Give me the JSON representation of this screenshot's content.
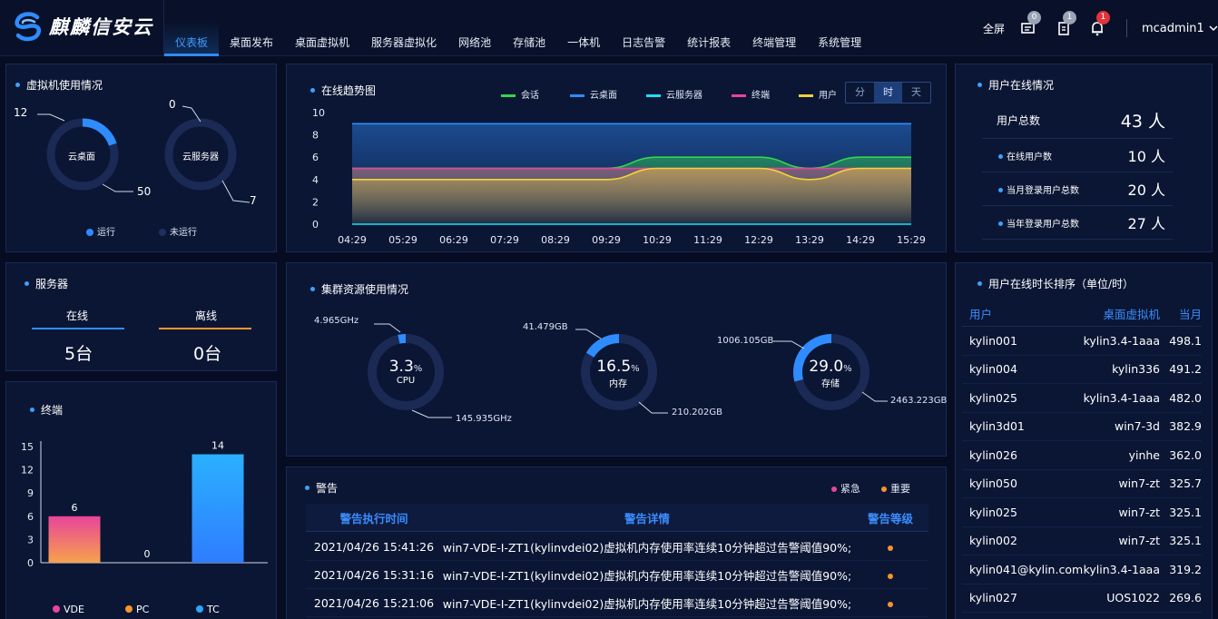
{
  "app": {
    "logo_text": "麒麟信安云"
  },
  "nav": {
    "items": [
      "仪表板",
      "桌面发布",
      "桌面虚拟机",
      "服务器虚拟化",
      "网络池",
      "存储池",
      "一体机",
      "日志告警",
      "统计报表",
      "终端管理",
      "系统管理"
    ],
    "active_index": 0
  },
  "header": {
    "fullscreen": "全屏",
    "badges": [
      "0",
      "1",
      "1"
    ],
    "user": "mcadmin1"
  },
  "colors": {
    "accent": "#2f8cff",
    "green": "#32d64c",
    "blue": "#2f8cff",
    "cyan": "#17e2f5",
    "pink": "#e8459b",
    "yellow": "#f4d23a"
  },
  "vm_usage": {
    "title": "虚拟机使用情况",
    "desktop": {
      "label": "云桌面",
      "running": "12",
      "idle": "50"
    },
    "server": {
      "label": "云服务器",
      "running": "0",
      "idle": "7"
    },
    "legend_running": "运行",
    "legend_idle": "未运行"
  },
  "servers": {
    "title": "服务器",
    "online_label": "在线",
    "offline_label": "离线",
    "online": "5台",
    "offline": "0台"
  },
  "terminals": {
    "title": "终端"
  },
  "trend": {
    "title": "在线趋势图",
    "legend": [
      "会话",
      "云桌面",
      "云服务器",
      "终端",
      "用户"
    ],
    "segments": [
      "分",
      "时",
      "天"
    ],
    "active_segment": 1
  },
  "cluster": {
    "title": "集群资源使用情况",
    "cpu": {
      "pct": "3.3",
      "label": "CPU",
      "used": "4.965GHz",
      "total": "145.935GHz",
      "value": 3.3
    },
    "mem": {
      "pct": "16.5",
      "label": "内存",
      "used": "41.479GB",
      "total": "210.202GB",
      "value": 16.5
    },
    "storage": {
      "pct": "29.0",
      "label": "存储",
      "used": "1006.105GB",
      "total": "2463.223GB",
      "value": 29.0
    },
    "unit": "%"
  },
  "alerts": {
    "title": "警告",
    "legend": [
      "紧急",
      "重要"
    ],
    "headers": [
      "警告执行时间",
      "警告详情",
      "警告等级"
    ],
    "rows": [
      {
        "time": "2021/04/26 15:41:26",
        "detail": "win7-VDE-I-ZT1(kylinvdei02)虚拟机内存使用率连续10分钟超过告警阈值90%;"
      },
      {
        "time": "2021/04/26 15:31:16",
        "detail": "win7-VDE-I-ZT1(kylinvdei02)虚拟机内存使用率连续10分钟超过告警阈值90%;"
      },
      {
        "time": "2021/04/26 15:21:06",
        "detail": "win7-VDE-I-ZT1(kylinvdei02)虚拟机内存使用率连续10分钟超过告警阈值90%;"
      }
    ]
  },
  "user_online": {
    "title": "用户在线情况",
    "total_label": "用户总数",
    "total": "43 人",
    "rows": [
      {
        "label": "在线用户数",
        "value": "10 人"
      },
      {
        "label": "当月登录用户总数",
        "value": "20 人"
      },
      {
        "label": "当年登录用户总数",
        "value": "27 人"
      }
    ]
  },
  "ranking": {
    "title": "用户在线时长排序（单位/时）",
    "headers": [
      "用户",
      "桌面虚拟机",
      "当月"
    ],
    "rows": [
      [
        "kylin001",
        "kylin3.4-1aaa",
        "498.1"
      ],
      [
        "kylin004",
        "kylin336",
        "491.2"
      ],
      [
        "kylin025",
        "kylin3.4-1aaa",
        "482.0"
      ],
      [
        "kylin3d01",
        "win7-3d",
        "382.9"
      ],
      [
        "kylin026",
        "yinhe",
        "362.0"
      ],
      [
        "kylin050",
        "win7-zt",
        "325.7"
      ],
      [
        "kylin025",
        "win7-zt",
        "325.1"
      ],
      [
        "kylin002",
        "win7-zt",
        "325.1"
      ],
      [
        "kylin041@kylin.com",
        "kylin3.4-1aaa",
        "319.2"
      ],
      [
        "kylin027",
        "UOS1022",
        "269.6"
      ]
    ]
  },
  "chart_data": [
    {
      "type": "area",
      "title": "在线趋势图",
      "x": [
        "04:29",
        "05:29",
        "06:29",
        "07:29",
        "08:29",
        "09:29",
        "10:29",
        "11:29",
        "12:29",
        "13:29",
        "14:29",
        "15:29"
      ],
      "ylim": [
        0,
        10
      ],
      "yticks": [
        0,
        2,
        4,
        6,
        8,
        10
      ],
      "series": [
        {
          "name": "云桌面",
          "color": "#2f8cff",
          "values": [
            9,
            9,
            9,
            9,
            9,
            9,
            9,
            9,
            9,
            9,
            9,
            9
          ]
        },
        {
          "name": "会话",
          "color": "#32d64c",
          "values": [
            5,
            5,
            5,
            5,
            5,
            5,
            6,
            6,
            6,
            5,
            6,
            6
          ]
        },
        {
          "name": "终端",
          "color": "#e8459b",
          "values": [
            5,
            5,
            5,
            5,
            5,
            5,
            5,
            5,
            5,
            5,
            5,
            5
          ]
        },
        {
          "name": "用户",
          "color": "#f4d23a",
          "values": [
            4,
            4,
            4,
            4,
            4,
            4,
            5,
            5,
            5,
            4,
            5,
            5
          ]
        },
        {
          "name": "云服务器",
          "color": "#17e2f5",
          "values": [
            0,
            0,
            0,
            0,
            0,
            0,
            0,
            0,
            0,
            0,
            0,
            0
          ]
        }
      ]
    },
    {
      "type": "bar",
      "title": "终端",
      "categories": [
        "VDE",
        "PC",
        "TC"
      ],
      "values": [
        6,
        0,
        14
      ],
      "ylim": [
        0,
        15
      ],
      "yticks": [
        0,
        3,
        6,
        9,
        12,
        15
      ],
      "colors": [
        "#e8459b",
        "#f7952b",
        "#2aa6ff"
      ]
    }
  ]
}
